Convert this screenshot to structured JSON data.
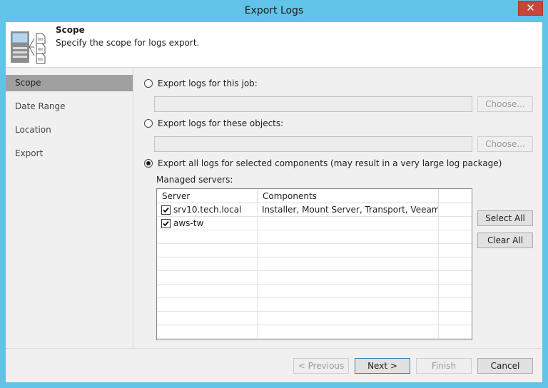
{
  "window": {
    "title": "Export Logs"
  },
  "header": {
    "title": "Scope",
    "subtitle": "Specify the scope for logs export."
  },
  "steps": [
    "Scope",
    "Date Range",
    "Location",
    "Export"
  ],
  "options": {
    "job_label": "Export logs for this job:",
    "objects_label": "Export logs for these objects:",
    "all_label": "Export all logs for selected components (may result in a very large log package)",
    "choose_label": "Choose..."
  },
  "managed": {
    "label": "Managed servers:",
    "columns": [
      "Server",
      "Components"
    ],
    "rows": [
      {
        "server": "srv10.tech.local",
        "components": "Installer, Mount Server, Transport, Veeam B...",
        "checked": true
      },
      {
        "server": "aws-tw",
        "components": "",
        "checked": true
      }
    ],
    "select_all": "Select All",
    "clear_all": "Clear All"
  },
  "footer": {
    "previous": "< Previous",
    "next": "Next >",
    "finish": "Finish",
    "cancel": "Cancel"
  }
}
